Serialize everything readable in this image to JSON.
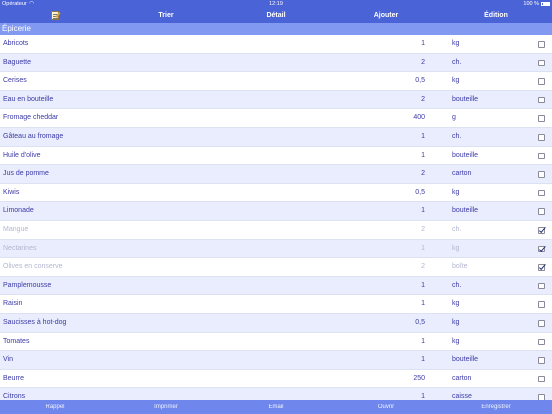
{
  "status_bar": {
    "operator": "Opérateur",
    "time": "12:19",
    "battery": "100 %"
  },
  "toolbar": {
    "sort_label": "Trier",
    "detail_label": "Détail",
    "add_label": "Ajouter",
    "edit_label": "Édition"
  },
  "section": {
    "title": "Épicerie"
  },
  "items": [
    {
      "name": "Abricots",
      "qty": "1",
      "unit": "kg",
      "checked": false
    },
    {
      "name": "Baguette",
      "qty": "2",
      "unit": "ch.",
      "checked": false
    },
    {
      "name": "Cerises",
      "qty": "0,5",
      "unit": "kg",
      "checked": false
    },
    {
      "name": "Eau en bouteille",
      "qty": "2",
      "unit": "bouteille",
      "checked": false
    },
    {
      "name": "Fromage cheddar",
      "qty": "400",
      "unit": "g",
      "checked": false
    },
    {
      "name": "Gâteau au fromage",
      "qty": "1",
      "unit": "ch.",
      "checked": false
    },
    {
      "name": "Huile d'olive",
      "qty": "1",
      "unit": "bouteille",
      "checked": false
    },
    {
      "name": "Jus de pomme",
      "qty": "2",
      "unit": "carton",
      "checked": false
    },
    {
      "name": "Kiwis",
      "qty": "0,5",
      "unit": "kg",
      "checked": false
    },
    {
      "name": "Limonade",
      "qty": "1",
      "unit": "bouteille",
      "checked": false
    },
    {
      "name": "Mangue",
      "qty": "2",
      "unit": "ch.",
      "checked": true
    },
    {
      "name": "Nectarines",
      "qty": "1",
      "unit": "kg",
      "checked": true
    },
    {
      "name": "Olives en conserve",
      "qty": "2",
      "unit": "boîte",
      "checked": true
    },
    {
      "name": "Pamplemousse",
      "qty": "1",
      "unit": "ch.",
      "checked": false
    },
    {
      "name": "Raisin",
      "qty": "1",
      "unit": "kg",
      "checked": false
    },
    {
      "name": "Saucisses à hot-dog",
      "qty": "0,5",
      "unit": "kg",
      "checked": false
    },
    {
      "name": "Tomates",
      "qty": "1",
      "unit": "kg",
      "checked": false
    },
    {
      "name": "Vin",
      "qty": "1",
      "unit": "bouteille",
      "checked": false
    },
    {
      "name": "Beurre",
      "qty": "250",
      "unit": "carton",
      "checked": false
    },
    {
      "name": "Citrons",
      "qty": "1",
      "unit": "caisse",
      "checked": false
    }
  ],
  "bottom_bar": {
    "reminder_label": "Rappel",
    "print_label": "Imprimer",
    "email_label": "Email",
    "open_label": "Ouvrir",
    "save_label": "Enregistrer"
  },
  "colors": {
    "bar_blue": "#4a63d6",
    "section_blue": "#8199f0",
    "stripe": "#e9edfd",
    "text_purple": "#3c3aa6"
  }
}
